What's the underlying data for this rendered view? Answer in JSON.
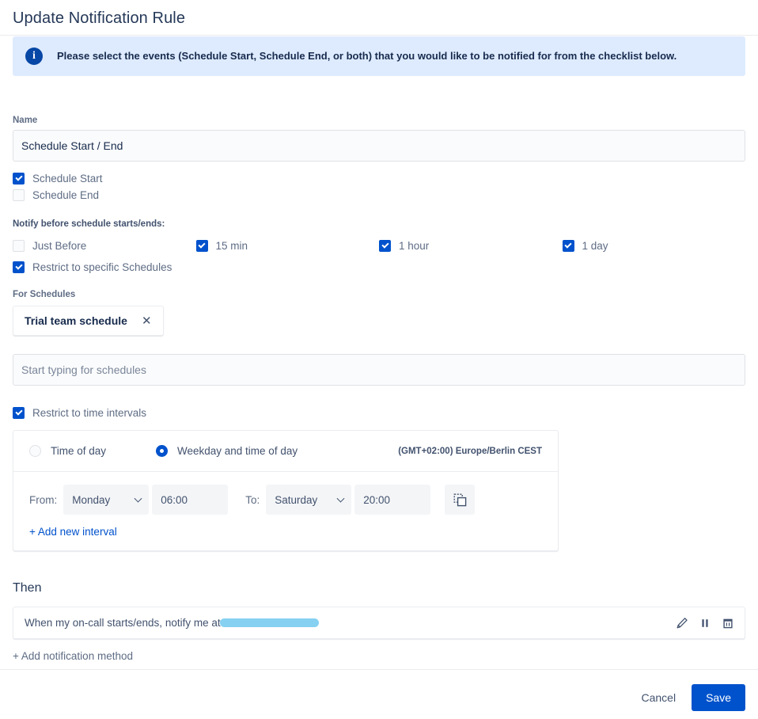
{
  "header": {
    "title": "Update Notification Rule"
  },
  "banner": {
    "icon": "info-icon",
    "icon_glyph": "i",
    "text": "Please select the events (Schedule Start, Schedule End, or both) that you would like to be notified for from the checklist below.",
    "background_color": "#deebff",
    "icon_color": "#0747a6"
  },
  "name_field": {
    "label": "Name",
    "value": "Schedule Start / End",
    "placeholder": "Name"
  },
  "event_checkboxes": [
    {
      "label": "Schedule Start",
      "checked": true
    },
    {
      "label": "Schedule End",
      "checked": false
    }
  ],
  "notify_before": {
    "heading": "Notify before schedule starts/ends:",
    "options": [
      {
        "label": "Just Before",
        "checked": false
      },
      {
        "label": "15 min",
        "checked": true
      },
      {
        "label": "1 hour",
        "checked": true
      },
      {
        "label": "1 day",
        "checked": true
      }
    ]
  },
  "restrict_schedules": {
    "label": "Restrict to specific Schedules",
    "checked": true
  },
  "for_schedules": {
    "label": "For Schedules",
    "tags": [
      {
        "label": "Trial team schedule",
        "remove_icon": "close-icon"
      }
    ],
    "input_value": "",
    "input_placeholder": "Start typing for schedules"
  },
  "restrict_intervals": {
    "label": "Restrict to time intervals",
    "checked": true
  },
  "interval_panel": {
    "mode_options": [
      {
        "label": "Time of day",
        "selected": false
      },
      {
        "label": "Weekday and time of day",
        "selected": true
      }
    ],
    "timezone": "(GMT+02:00) Europe/Berlin CEST",
    "interval": {
      "from_label": "From:",
      "from_day": "Monday",
      "from_time": "06:00",
      "to_label": "To:",
      "to_day": "Saturday",
      "to_time": "20:00",
      "duplicate_icon": "duplicate-icon"
    },
    "add_interval_link": "+ Add new interval"
  },
  "then_section": {
    "heading": "Then",
    "method": {
      "text_prefix": "When my on-call starts/ends, notify me at ",
      "redacted_value": "                              ",
      "redaction_color": "#7fcdf0",
      "actions": [
        {
          "name": "edit-icon",
          "title": "Edit"
        },
        {
          "name": "pause-icon",
          "title": "Pause"
        },
        {
          "name": "delete-icon",
          "title": "Delete"
        }
      ]
    },
    "add_method_link": "+ Add notification method"
  },
  "footer": {
    "cancel_label": "Cancel",
    "save_label": "Save",
    "save_color": "#0052cc"
  }
}
